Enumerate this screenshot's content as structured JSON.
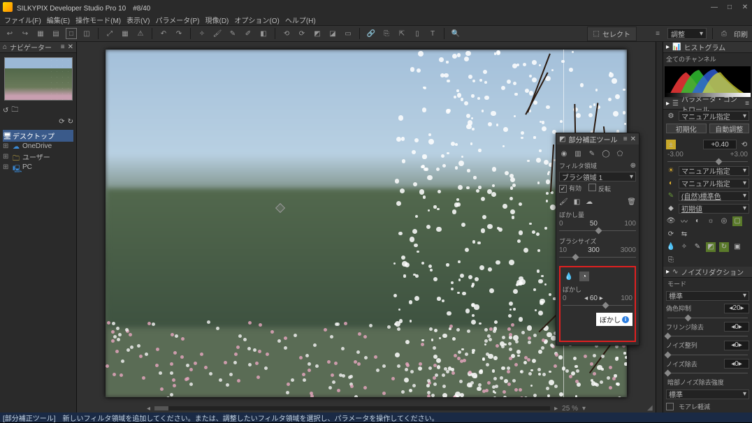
{
  "title": "SILKYPIX Developer Studio Pro 10　#8/40",
  "menus": [
    "ファイル(F)",
    "編集(E)",
    "操作モード(M)",
    "表示(V)",
    "パラメータ(P)",
    "現像(D)",
    "オプション(O)",
    "ヘルプ(H)"
  ],
  "toolbar_right": {
    "select": "セレクト",
    "adjust": "調整",
    "print": "印刷"
  },
  "navigator": {
    "title": "ナビゲーター"
  },
  "tree": {
    "root": "デスクトップ",
    "items": [
      "OneDrive",
      "ユーザー",
      "PC"
    ]
  },
  "zoom": "25 %",
  "histogram": {
    "title": "ヒストグラム",
    "channel_label": "全てのチャンネル"
  },
  "param_ctrl": {
    "title": "パラメータ・コントロール",
    "dd": "マニュアル指定",
    "init": "初期化",
    "auto": "自動調整",
    "ev": "+0.40",
    "ev_min": "-3.00",
    "ev_max": "+3.00",
    "dd2": "マニュアル指定",
    "dd3": "マニュアル指定",
    "dd4": "(自然)標準色",
    "dd5": "初期値"
  },
  "noise": {
    "title": "ノイズリダクション",
    "mode_label": "モード",
    "mode": "標準",
    "false_color": "偽色抑制",
    "false_color_v": "20",
    "fringe": "フリンジ除去",
    "fringe_v": "0",
    "nr_arr": "ノイズ整列",
    "nr_arr_v": "0",
    "nr_rem": "ノイズ除去",
    "nr_rem_v": "0",
    "dark_label": "暗部ノイズ除去強度",
    "dark": "標準",
    "moire": "モアレ軽減"
  },
  "float": {
    "title": "部分補正ツール",
    "filt_area": "フィルタ領域",
    "brush_area": "ブラシ領域 1",
    "enable": "有効",
    "invert": "反転",
    "blur_amt": "ぼかし量",
    "blur_amt_min": "0",
    "blur_amt_mid": "50",
    "blur_amt_max": "100",
    "brush_size": "ブラシサイズ",
    "brush_min": "10",
    "brush_mid": "300",
    "brush_max": "3000",
    "bokeh": "ぼかし",
    "bokeh_min": "0",
    "bokeh_mid": "60",
    "bokeh_max": "100",
    "bokeh_btn": "ぼかし"
  },
  "status": "[部分補正ツール]　新しいフィルタ領域を追加してください。または、調整したいフィルタ領域を選択し、パラメータを操作してください。"
}
